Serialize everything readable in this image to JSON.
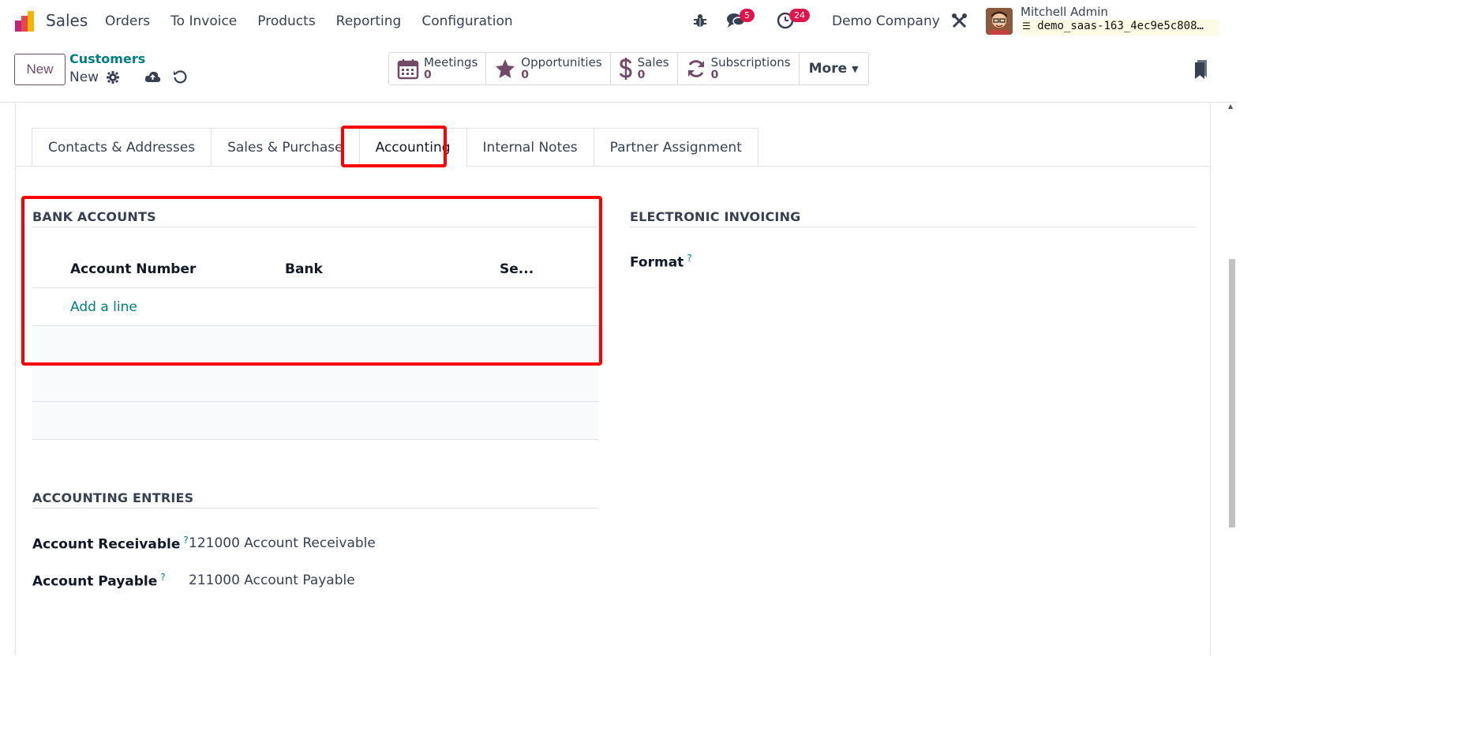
{
  "navbar": {
    "app_name": "Sales",
    "menu": [
      "Orders",
      "To Invoice",
      "Products",
      "Reporting",
      "Configuration"
    ],
    "messages_count": "5",
    "activities_count": "24",
    "company": "Demo Company",
    "user_name": "Mitchell Admin",
    "database": "demo_saas-163_4ec9e5c808…"
  },
  "control_panel": {
    "new_label": "New",
    "breadcrumb_parent": "Customers",
    "breadcrumb_current": "New",
    "smart_buttons": [
      {
        "label": "Meetings",
        "value": "0",
        "icon": "calendar-icon"
      },
      {
        "label": "Opportunities",
        "value": "0",
        "icon": "star-icon"
      },
      {
        "label": "Sales",
        "value": "0",
        "icon": "dollar-icon"
      },
      {
        "label": "Subscriptions",
        "value": "0",
        "icon": "refresh-icon"
      }
    ],
    "more_label": "More"
  },
  "tabs": [
    "Contacts & Addresses",
    "Sales & Purchase",
    "Accounting",
    "Internal Notes",
    "Partner Assignment"
  ],
  "active_tab": "Accounting",
  "bank_accounts": {
    "title": "BANK ACCOUNTS",
    "columns": [
      "Account Number",
      "Bank",
      "Se..."
    ],
    "add_line": "Add a line"
  },
  "electronic_invoicing": {
    "title": "ELECTRONIC INVOICING",
    "format_label": "Format",
    "help_mark": "?"
  },
  "accounting_entries": {
    "title": "ACCOUNTING ENTRIES",
    "receivable_label": "Account Receivable",
    "receivable_value": "121000 Account Receivable",
    "payable_label": "Account Payable",
    "payable_value": "211000 Account Payable",
    "help_mark": "?"
  },
  "colors": {
    "brand": "#714b67",
    "link": "#017e84",
    "highlight": "#ff0000",
    "badge": "#e0154b"
  }
}
